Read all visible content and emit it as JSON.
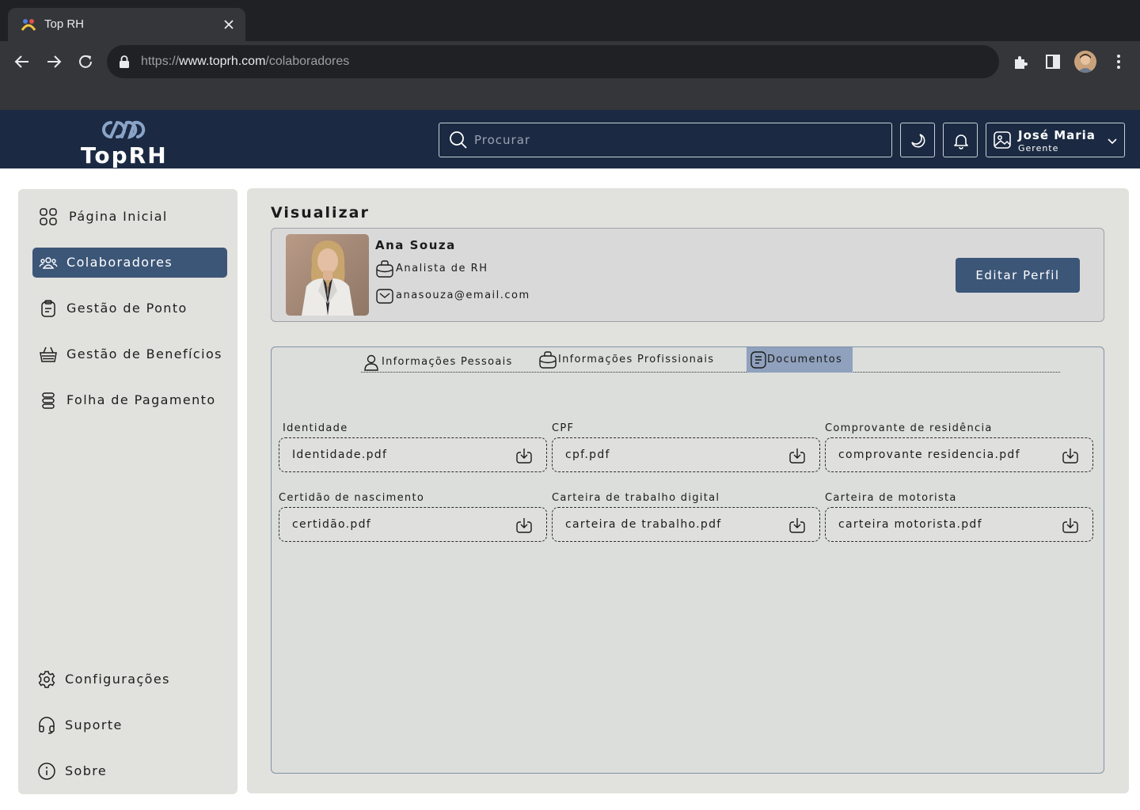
{
  "browser": {
    "tab_title": "Top RH",
    "url_prefix": "https://",
    "url_host": "www.toprh.com",
    "url_path": "/colaboradores"
  },
  "app": {
    "logo_text": "TopRH",
    "search_placeholder": "Procurar",
    "user": {
      "name": "José Maria",
      "role": "Gerente"
    }
  },
  "sidebar": {
    "items": [
      {
        "label": "Página Inicial",
        "icon": "grid-icon",
        "active": false
      },
      {
        "label": "Colaboradores",
        "icon": "users-icon",
        "active": true
      },
      {
        "label": "Gestão de Ponto",
        "icon": "clipboard-icon",
        "active": false
      },
      {
        "label": "Gestão de Benefícios",
        "icon": "basket-icon",
        "active": false
      },
      {
        "label": "Folha de Pagamento",
        "icon": "coins-icon",
        "active": false
      }
    ],
    "bottom_items": [
      {
        "label": "Configurações",
        "icon": "gear-icon"
      },
      {
        "label": "Suporte",
        "icon": "headset-icon"
      },
      {
        "label": "Sobre",
        "icon": "info-icon"
      }
    ]
  },
  "main": {
    "title": "Visualizar",
    "profile": {
      "name": "Ana Souza",
      "job_title": "Analista de RH",
      "email": "anasouza@email.com",
      "edit_button": "Editar Perfil"
    },
    "tabs": [
      {
        "label": "Informações Pessoais",
        "icon": "person-icon",
        "active": false
      },
      {
        "label": "Informações Profissionais",
        "icon": "briefcase-icon",
        "active": false
      },
      {
        "label": "Documentos",
        "icon": "document-icon",
        "active": true
      }
    ],
    "documents": [
      {
        "label": "Identidade",
        "file": "Identidade.pdf"
      },
      {
        "label": "CPF",
        "file": "cpf.pdf"
      },
      {
        "label": "Comprovante de residência",
        "file": "comprovante residencia.pdf"
      },
      {
        "label": "Certidão de nascimento",
        "file": "certidão.pdf"
      },
      {
        "label": "Carteira de trabalho digital",
        "file": "carteira de trabalho.pdf"
      },
      {
        "label": "Carteira de motorista",
        "file": "carteira motorista.pdf"
      }
    ]
  },
  "colors": {
    "header_bg": "#1b2a42",
    "accent": "#3c5678",
    "active_tab": "#8fa1bd",
    "panel_bg": "#e1e1dd"
  }
}
